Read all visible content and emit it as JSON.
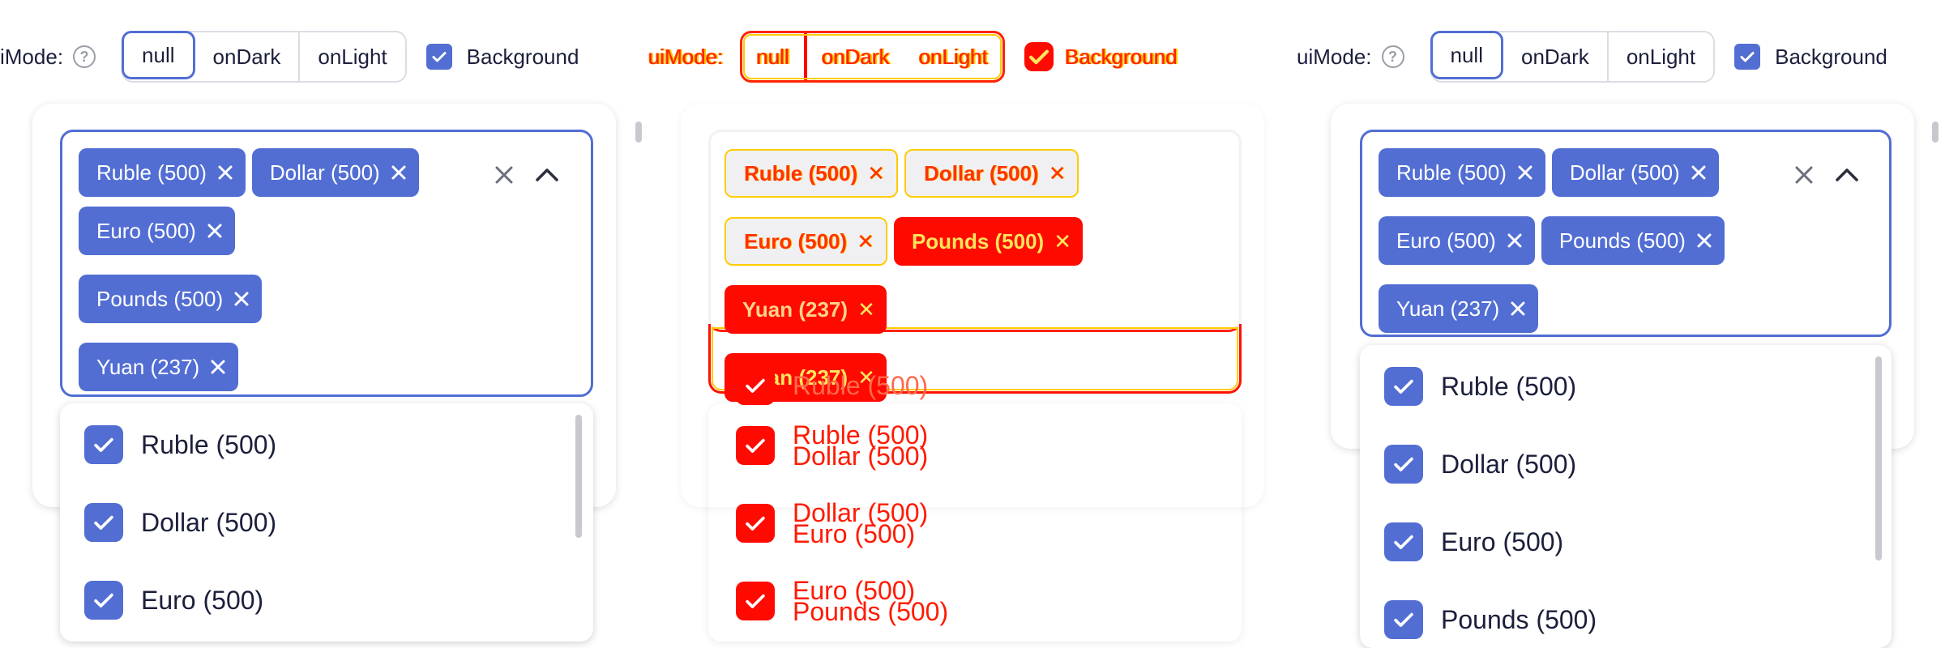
{
  "toolbar": {
    "label_left": "iMode:",
    "label_right": "uiMode:",
    "help_glyph": "?",
    "modes": [
      "null",
      "onDark",
      "onLight"
    ],
    "active_mode": "null",
    "background_label": "Background",
    "background_checked": true
  },
  "diff_toolbar": {
    "label": "uiMode:",
    "modes": [
      "null",
      "onDark",
      "onLight"
    ],
    "background_label": "Background"
  },
  "field": {
    "chips": [
      {
        "label": "Ruble (500)"
      },
      {
        "label": "Dollar (500)"
      },
      {
        "label": "Euro (500)"
      },
      {
        "label": "Pounds (500)"
      },
      {
        "label": "Yuan (237)"
      }
    ]
  },
  "dropdown_left": {
    "items": [
      {
        "label": "Ruble (500)",
        "checked": true
      },
      {
        "label": "Dollar (500)",
        "checked": true
      },
      {
        "label": "Euro (500)",
        "checked": true
      }
    ]
  },
  "dropdown_right": {
    "items": [
      {
        "label": "Ruble (500)",
        "checked": true
      },
      {
        "label": "Dollar (500)",
        "checked": true
      },
      {
        "label": "Euro (500)",
        "checked": true
      },
      {
        "label": "Pounds (500)",
        "checked": true
      }
    ]
  },
  "diff_dropdown": {
    "items": [
      {
        "label": "Ruble (500)",
        "ghost": ""
      },
      {
        "label": "Ruble (500)",
        "ghost": "Dollar (500)"
      },
      {
        "label": "Dollar (500)",
        "ghost": "Euro (500)"
      },
      {
        "label": "Euro (500)",
        "ghost": "Pounds (500)"
      }
    ]
  },
  "colors": {
    "accent": "#526ed3",
    "diff_red": "#ff0a00",
    "diff_yellow": "#ffcc00",
    "text": "#1b1f3b"
  }
}
